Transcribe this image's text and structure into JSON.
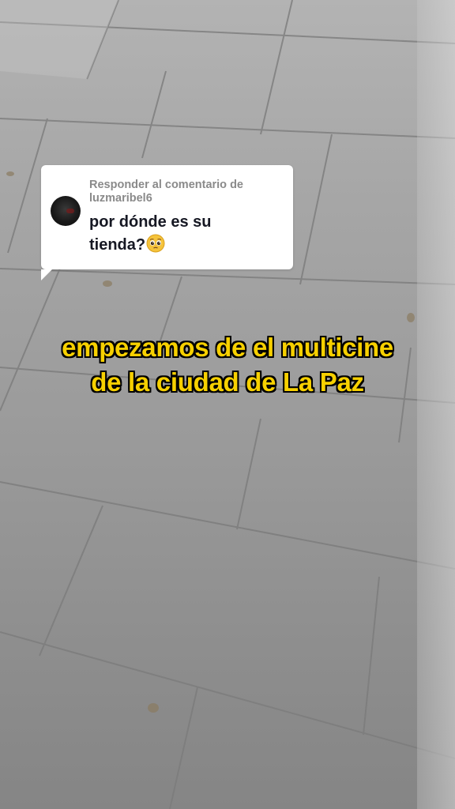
{
  "comment_card": {
    "reply_prefix": "Responder al comentario de",
    "username": "luzmaribel6",
    "comment_line1": "por dónde es su",
    "comment_line2": "tienda?",
    "emoji": "pleading-face-emoji"
  },
  "caption": {
    "line1": "empezamos de el multicine",
    "line2": "de la ciudad de La Paz"
  },
  "colors": {
    "caption_fill": "#f7d000",
    "caption_outline": "#000000",
    "card_background": "#ffffff",
    "card_header_text": "#8a8a8a",
    "card_body_text": "#161823"
  }
}
